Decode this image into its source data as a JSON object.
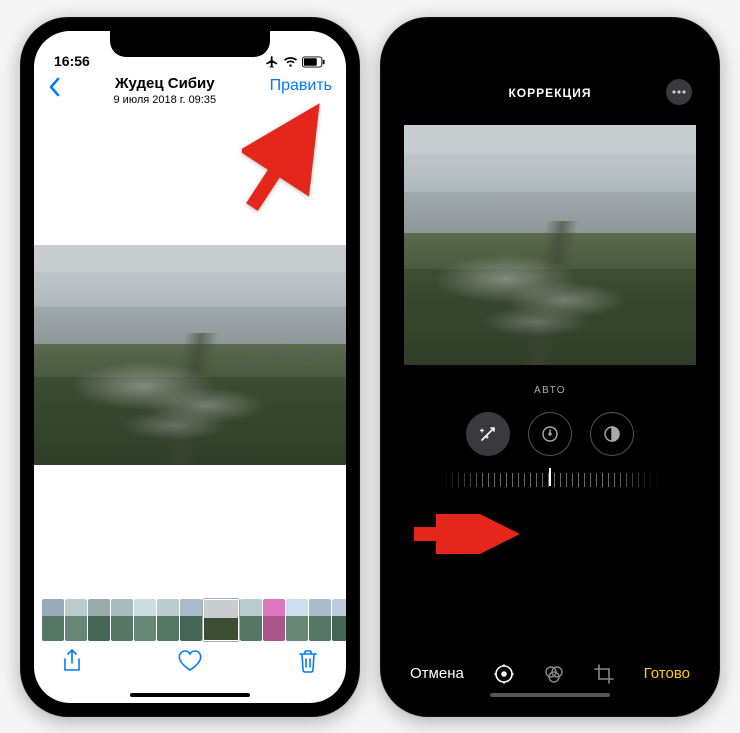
{
  "left": {
    "status": {
      "time": "16:56"
    },
    "header": {
      "back_icon": "chevron-left",
      "title": "Жудец Сибиу",
      "subtitle": "9 июля 2018 г.  09:35",
      "edit_label": "Править"
    },
    "watermark": "Яблык",
    "thumbnails": {
      "count": 14,
      "current_index": 7
    },
    "toolbar": {
      "share_icon": "share",
      "favorite_icon": "heart",
      "trash_icon": "trash"
    }
  },
  "right": {
    "header": {
      "title": "КОРРЕКЦИЯ",
      "more_icon": "ellipsis"
    },
    "adjust": {
      "label": "АВТО",
      "buttons": [
        {
          "name": "auto-wand",
          "icon": "wand",
          "active": true
        },
        {
          "name": "exposure",
          "icon": "exposure",
          "active": false
        },
        {
          "name": "brilliance",
          "icon": "contrast",
          "active": false
        }
      ]
    },
    "bottom": {
      "cancel_label": "Отмена",
      "done_label": "Готово",
      "modes": [
        {
          "name": "adjust-mode",
          "icon": "adjust-dial",
          "active": true
        },
        {
          "name": "filters-mode",
          "icon": "filters-circles",
          "active": false
        },
        {
          "name": "crop-mode",
          "icon": "crop",
          "active": false
        }
      ]
    }
  },
  "colors": {
    "ios_blue": "#007aff",
    "ios_yellow": "#ffcc00",
    "arrow_red": "#e4261b"
  }
}
